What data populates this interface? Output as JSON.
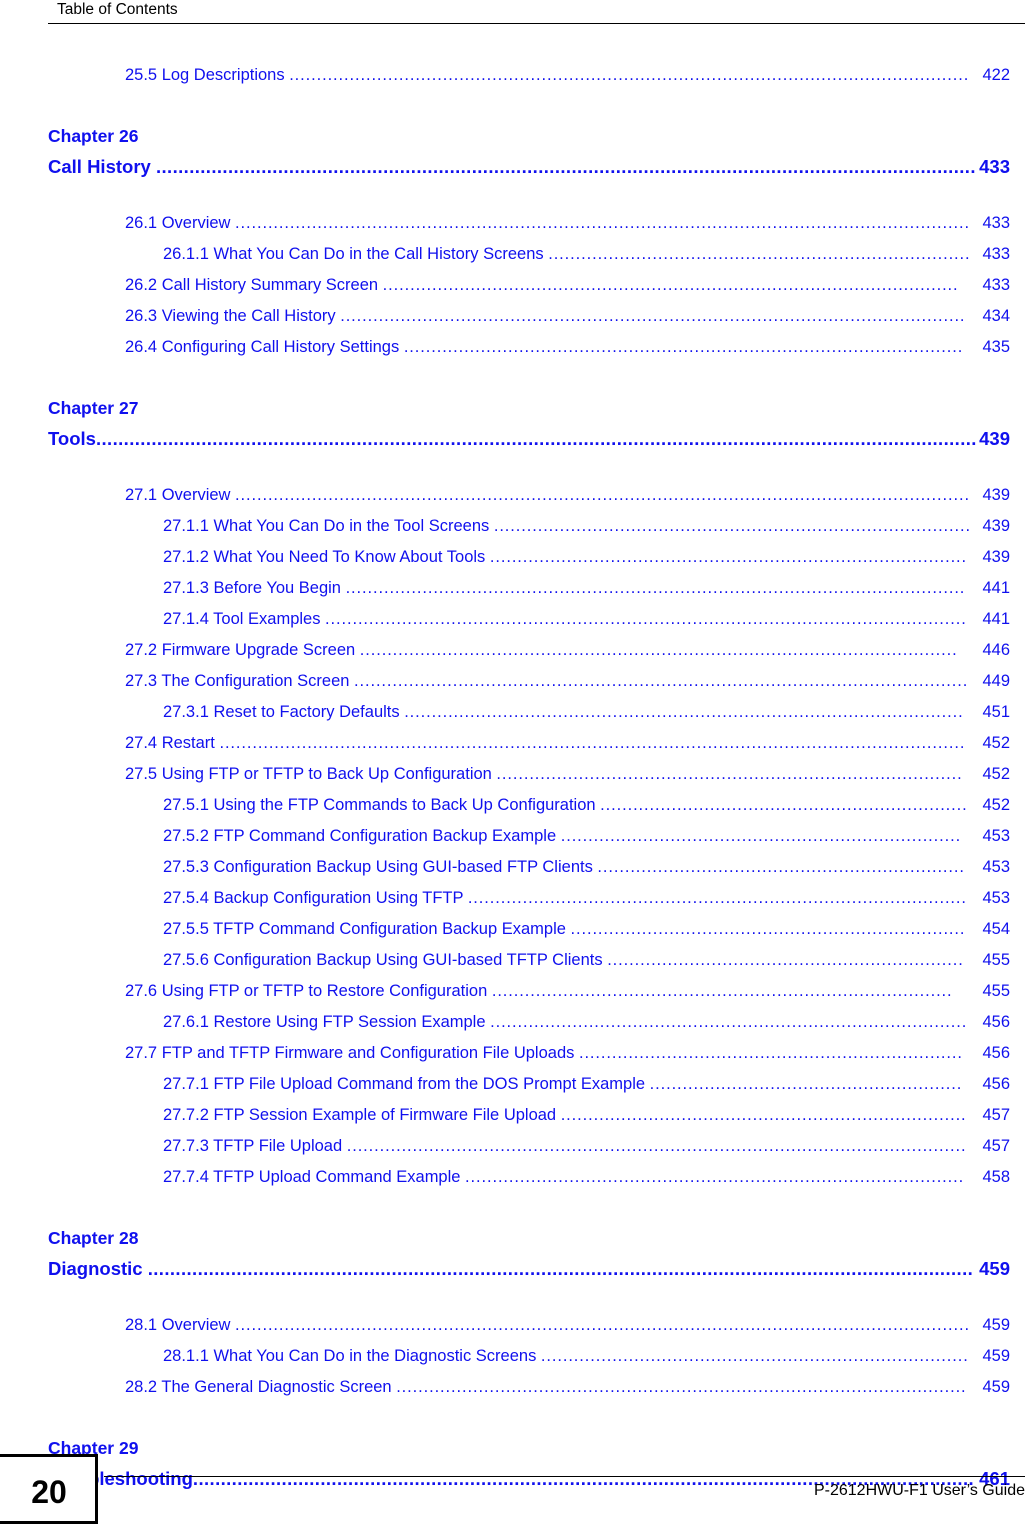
{
  "header": {
    "title": "Table of Contents"
  },
  "colors": {
    "link_blue": "#1010ee",
    "text_black": "#000000",
    "page_background": "#ffffff"
  },
  "toc": {
    "leading_entries": [
      {
        "level": 1,
        "label": "25.5 Log Descriptions ",
        "page": "422"
      }
    ],
    "chapters": [
      {
        "chapter_label": "Chapter  26",
        "chapter_title": "Call History ",
        "chapter_page": "433",
        "entries": [
          {
            "level": 1,
            "label": "26.1 Overview ",
            "page": "433"
          },
          {
            "level": 2,
            "label": "26.1.1 What You Can Do in the Call History Screens ",
            "page": "433"
          },
          {
            "level": 1,
            "label": "26.2 Call History Summary Screen   ",
            "page": "433"
          },
          {
            "level": 1,
            "label": "26.3 Viewing the Call History  ",
            "page": "434"
          },
          {
            "level": 1,
            "label": "26.4 Configuring Call History Settings  ",
            "page": "435"
          }
        ]
      },
      {
        "chapter_label": "Chapter  27",
        "chapter_title": "Tools",
        "chapter_page": "439",
        "entries": [
          {
            "level": 1,
            "label": "27.1 Overview ",
            "page": "439"
          },
          {
            "level": 2,
            "label": "27.1.1 What You Can Do in the Tool Screens ",
            "page": "439"
          },
          {
            "level": 2,
            "label": "27.1.2 What You Need To Know About Tools ",
            "page": "439"
          },
          {
            "level": 2,
            "label": "27.1.3 Before You Begin  ",
            "page": "441"
          },
          {
            "level": 2,
            "label": "27.1.4 Tool Examples ",
            "page": "441"
          },
          {
            "level": 1,
            "label": "27.2 Firmware Upgrade Screen    ",
            "page": "446"
          },
          {
            "level": 1,
            "label": "27.3 The Configuration Screen ",
            "page": "449"
          },
          {
            "level": 2,
            "label": "27.3.1 Reset to Factory Defaults  ",
            "page": "451"
          },
          {
            "level": 1,
            "label": "27.4 Restart  ",
            "page": "452"
          },
          {
            "level": 1,
            "label": "27.5 Using FTP or TFTP to Back Up Configuration  ",
            "page": "452"
          },
          {
            "level": 2,
            "label": "27.5.1 Using the FTP Commands to Back Up Configuration ",
            "page": "452"
          },
          {
            "level": 2,
            "label": "27.5.2 FTP Command  Configuration Backup Example  ",
            "page": "453"
          },
          {
            "level": 2,
            "label": "27.5.3 Configuration Backup Using GUI-based FTP Clients  ",
            "page": "453"
          },
          {
            "level": 2,
            "label": "27.5.4 Backup Configuration Using TFTP ",
            "page": "453"
          },
          {
            "level": 2,
            "label": "27.5.5 TFTP Command Configuration Backup Example  ",
            "page": "454"
          },
          {
            "level": 2,
            "label": "27.5.6 Configuration Backup Using GUI-based TFTP Clients  ",
            "page": "455"
          },
          {
            "level": 1,
            "label": "27.6 Using FTP or TFTP to Restore Configuration    ",
            "page": "455"
          },
          {
            "level": 2,
            "label": "27.6.1 Restore Using FTP Session Example ",
            "page": "456"
          },
          {
            "level": 1,
            "label": "27.7 FTP and TFTP Firmware and Configuration File Uploads  ",
            "page": "456"
          },
          {
            "level": 2,
            "label": "27.7.1 FTP File Upload Command from the DOS Prompt Example  ",
            "page": "456"
          },
          {
            "level": 2,
            "label": "27.7.2 FTP Session Example of Firmware File Upload  ",
            "page": "457"
          },
          {
            "level": 2,
            "label": "27.7.3 TFTP File Upload  ",
            "page": "457"
          },
          {
            "level": 2,
            "label": "27.7.4 TFTP Upload Command Example  ",
            "page": "458"
          }
        ]
      },
      {
        "chapter_label": "Chapter  28",
        "chapter_title": "Diagnostic ",
        "chapter_page": "459",
        "entries": [
          {
            "level": 1,
            "label": "28.1 Overview ",
            "page": "459"
          },
          {
            "level": 2,
            "label": "28.1.1 What You Can Do in the Diagnostic Screens ",
            "page": "459"
          },
          {
            "level": 1,
            "label": "28.2 The General Diagnostic Screen  ",
            "page": "459"
          }
        ]
      },
      {
        "chapter_label": "Chapter  29",
        "chapter_title": "Troubleshooting",
        "chapter_page": "461",
        "entries": []
      }
    ]
  },
  "footer": {
    "page_number": "20",
    "guide_title": "P-2612HWU-F1 User’s Guide"
  }
}
